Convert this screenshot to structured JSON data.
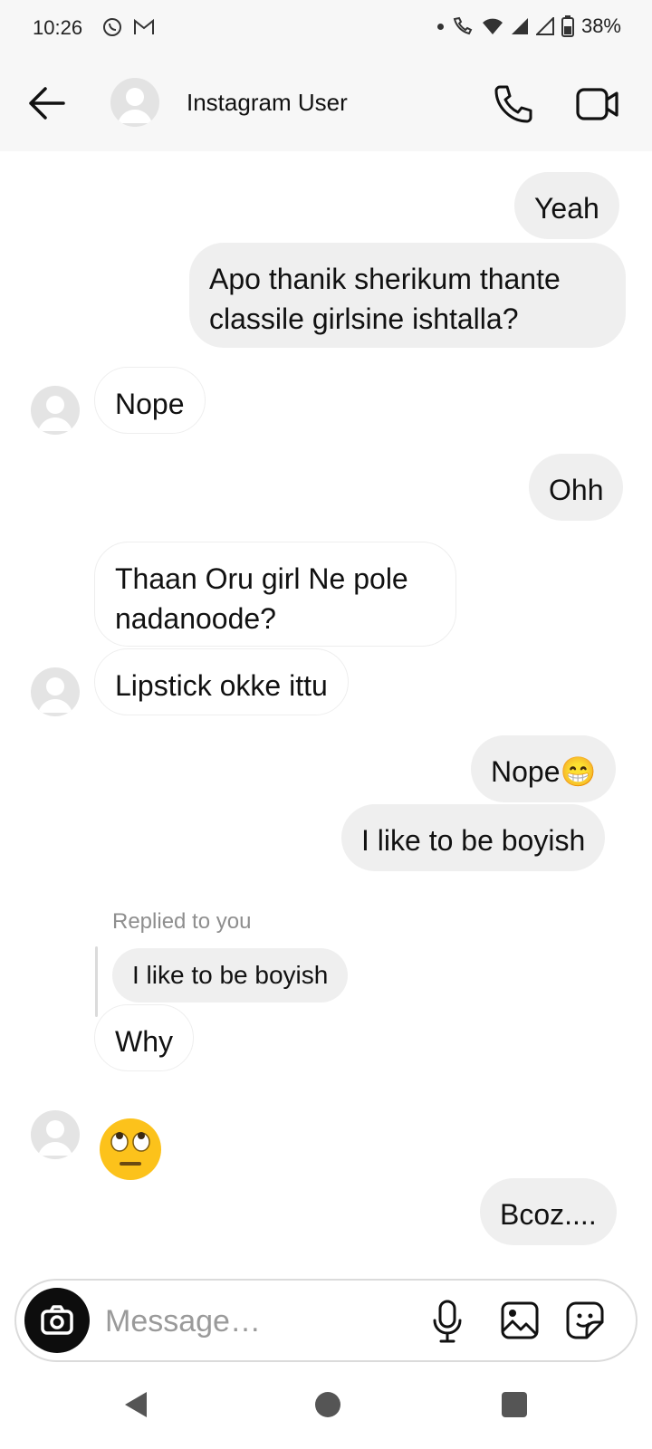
{
  "status_bar": {
    "time": "10:26",
    "battery": "38%"
  },
  "header": {
    "contact_name": "Instagram User"
  },
  "messages": [
    {
      "side": "out",
      "text": "Yeah"
    },
    {
      "side": "out",
      "text_lines": [
        "Apo thanik sherikum thante",
        "classile girlsine ishtalla?"
      ]
    },
    {
      "side": "in",
      "text": "Nope"
    },
    {
      "side": "out",
      "text": "Ohh"
    },
    {
      "side": "in",
      "text_lines": [
        "Thaan Oru girl Ne pole",
        "nadanoode?"
      ]
    },
    {
      "side": "in",
      "text": "Lipstick okke ittu"
    },
    {
      "side": "out",
      "text": "Nope😁"
    },
    {
      "side": "out",
      "text": "I like to be boyish"
    },
    {
      "side": "in",
      "reply_label": "Replied to you",
      "quoted": "I like to be boyish",
      "text": "Why"
    },
    {
      "side": "in",
      "emoji": "face-with-rolling-eyes-icon"
    },
    {
      "side": "out",
      "text": "Bcoz...."
    }
  ],
  "composer": {
    "placeholder": "Message…"
  },
  "colors": {
    "outgoing_bubble": "#efefef",
    "incoming_border": "#eeeeee",
    "emoji_yellow": "#fcc21b"
  }
}
